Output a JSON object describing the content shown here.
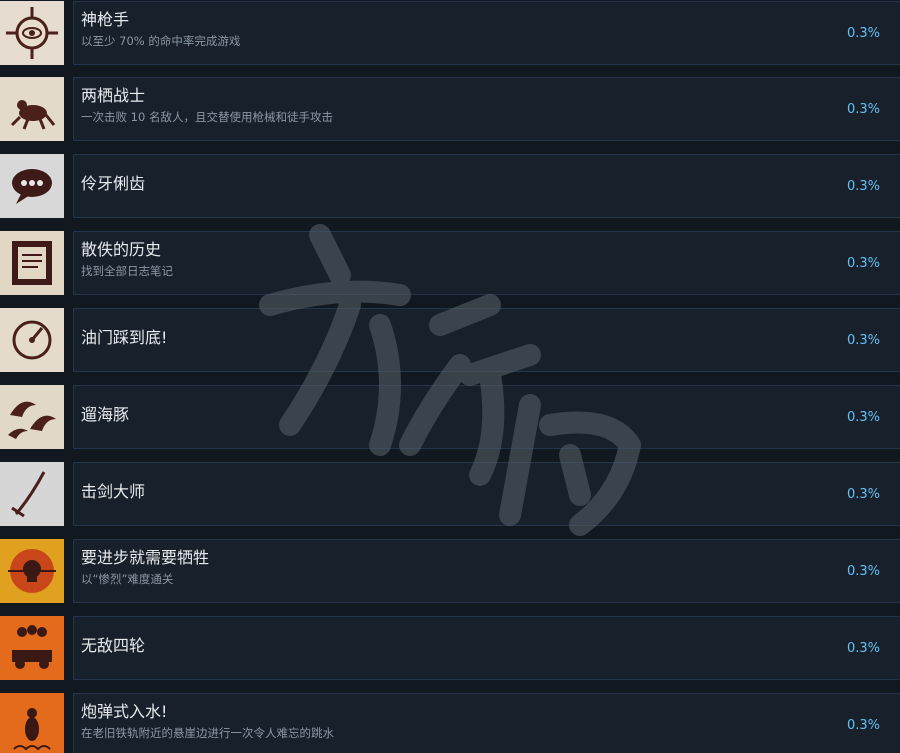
{
  "achievements": [
    {
      "title": "神枪手",
      "desc": "以至少 70% 的命中率完成游戏",
      "percent": "0.3%",
      "icon": "crosshair-eye-icon"
    },
    {
      "title": "两栖战士",
      "desc": "一次击败 10 名敌人，且交替使用枪械和徒手攻击",
      "percent": "0.3%",
      "icon": "frog-icon"
    },
    {
      "title": "伶牙俐齿",
      "desc": "",
      "percent": "0.3%",
      "icon": "speech-bubble-icon"
    },
    {
      "title": "散佚的历史",
      "desc": "找到全部日志笔记",
      "percent": "0.3%",
      "icon": "document-icon"
    },
    {
      "title": "油门踩到底!",
      "desc": "",
      "percent": "0.3%",
      "icon": "speedometer-icon"
    },
    {
      "title": "遛海豚",
      "desc": "",
      "percent": "0.3%",
      "icon": "dolphins-icon"
    },
    {
      "title": "击剑大师",
      "desc": "",
      "percent": "0.3%",
      "icon": "sword-icon"
    },
    {
      "title": "要进步就需要牺牲",
      "desc": "以“惨烈”难度通关",
      "percent": "0.3%",
      "icon": "skull-emblem-icon"
    },
    {
      "title": "无敌四轮",
      "desc": "",
      "percent": "0.3%",
      "icon": "skull-vehicle-icon"
    },
    {
      "title": "炮弹式入水!",
      "desc": "在老旧铁轨附近的悬崖边进行一次令人难忘的跳水",
      "percent": "0.3%",
      "icon": "diver-icon"
    }
  ],
  "colors": {
    "accent": "#66c0f4",
    "background": "#111820",
    "panel": "#17202b"
  }
}
